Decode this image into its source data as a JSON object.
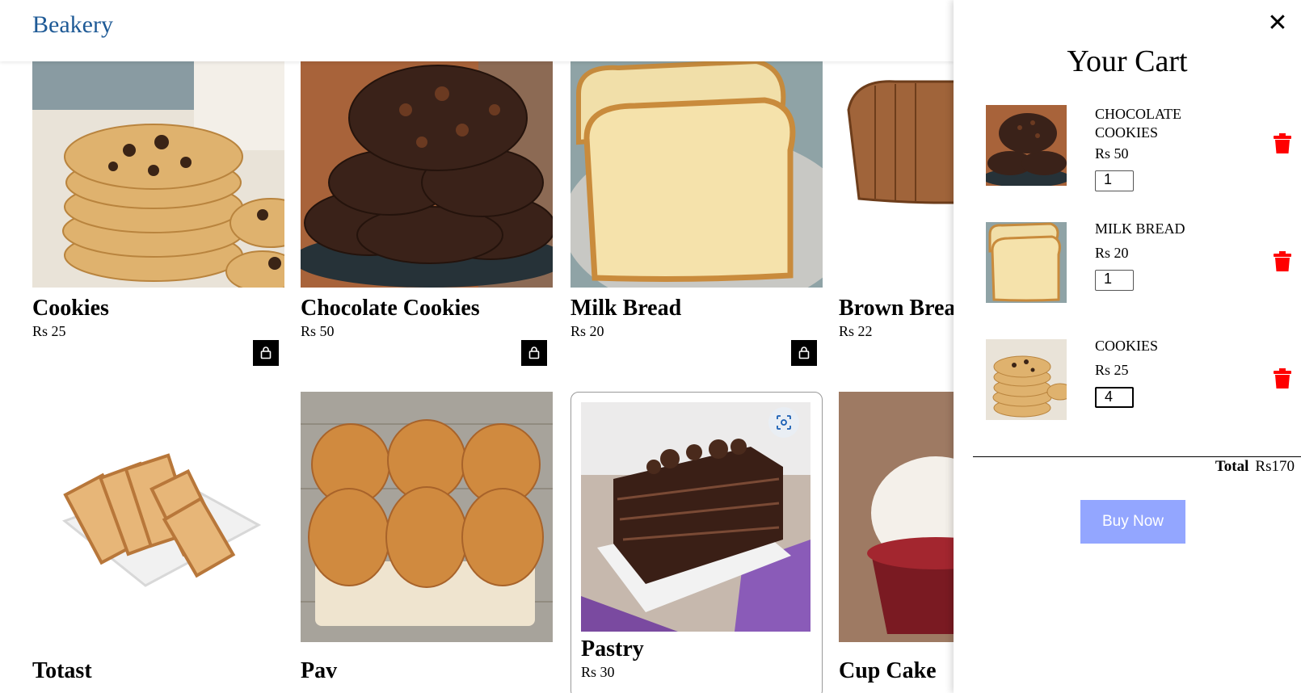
{
  "header": {
    "brand": "Beakery"
  },
  "products": [
    {
      "name": "Cookies",
      "price": "Rs 25",
      "image": "cookies"
    },
    {
      "name": "Chocolate Cookies",
      "price": "Rs 50",
      "image": "chocolate-cookies"
    },
    {
      "name": "Milk Bread",
      "price": "Rs 20",
      "image": "milk-bread"
    },
    {
      "name": "Brown Bread",
      "price": "Rs 22",
      "image": "brown-bread"
    },
    {
      "name": "Totast",
      "price": "",
      "image": "toast"
    },
    {
      "name": "Pav",
      "price": "",
      "image": "pav"
    },
    {
      "name": "Pastry",
      "price": "Rs 30",
      "image": "pastry"
    },
    {
      "name": "Cup Cake",
      "price": "",
      "image": "cup-cake"
    }
  ],
  "icons": {
    "add_to_cart": "shopping-bag-icon",
    "visual_search": "lens-icon",
    "remove": "trash-icon",
    "close": "close-icon"
  },
  "cart": {
    "title": "Your Cart",
    "close_glyph": "✕",
    "items": [
      {
        "name": "CHOCOLATE COOKIES",
        "price": "Rs 50",
        "qty": "1"
      },
      {
        "name": "MILK BREAD",
        "price": "Rs 20",
        "qty": "1"
      },
      {
        "name": "COOKIES",
        "price": "Rs 25",
        "qty": "4"
      }
    ],
    "total_label": "Total",
    "total_value": "Rs170",
    "buy_label": "Buy Now"
  },
  "colors": {
    "brand": "#1e5a96",
    "buy_button": "#93a6ff",
    "trash": "#ff0000",
    "bag_button": "#000000"
  }
}
